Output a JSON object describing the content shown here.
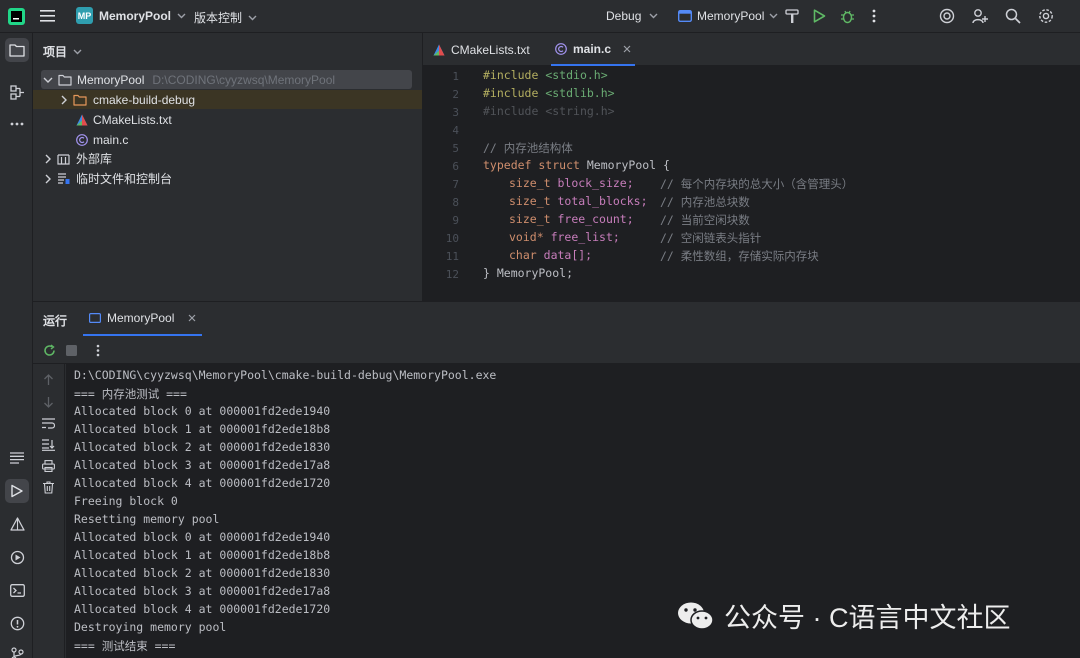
{
  "topbar": {
    "project_badge": "MP",
    "project_name": "MemoryPool",
    "vcs_label": "版本控制",
    "config_label": "Debug",
    "run_target": "MemoryPool"
  },
  "project_panel": {
    "title": "项目",
    "root_name": "MemoryPool",
    "root_path": "D:\\CODING\\cyyzwsq\\MemoryPool",
    "items": [
      {
        "label": "cmake-build-debug"
      },
      {
        "label": "CMakeLists.txt"
      },
      {
        "label": "main.c"
      },
      {
        "label": "外部库"
      },
      {
        "label": "临时文件和控制台"
      }
    ]
  },
  "editor": {
    "tabs": [
      {
        "label": "CMakeLists.txt"
      },
      {
        "label": "main.c"
      }
    ],
    "line_numbers": [
      "1",
      "2",
      "3",
      "4",
      "5",
      "6",
      "7",
      "8",
      "9",
      "10",
      "11",
      "12"
    ],
    "lines": {
      "l1_kw": "#include",
      "l1_val": "<stdio.h>",
      "l2_kw": "#include",
      "l2_val": "<stdlib.h>",
      "l3_kw": "#include",
      "l3_val": "<string.h>",
      "l5": "// 内存池结构体",
      "l6_kw": "typedef struct",
      "l6_rest": " MemoryPool {",
      "l7_type": "size_t",
      "l7_field": "block_size;",
      "l7_cm": "// 每个内存块的总大小（含管理头）",
      "l8_type": "size_t",
      "l8_field": "total_blocks;",
      "l8_cm": "// 内存池总块数",
      "l9_type": "size_t",
      "l9_field": "free_count;",
      "l9_cm": "// 当前空闲块数",
      "l10_type": "void*",
      "l10_field": "free_list;",
      "l10_cm": "// 空闲链表头指针",
      "l11_type": "char",
      "l11_field": "data[];",
      "l11_cm": "// 柔性数组，存储实际内存块",
      "l12": "} MemoryPool;"
    }
  },
  "run": {
    "title": "运行",
    "tab_label": "MemoryPool",
    "console": [
      "D:\\CODING\\cyyzwsq\\MemoryPool\\cmake-build-debug\\MemoryPool.exe",
      "=== 内存池测试 ===",
      "Allocated block 0 at 000001fd2ede1940",
      "Allocated block 1 at 000001fd2ede18b8",
      "Allocated block 2 at 000001fd2ede1830",
      "Allocated block 3 at 000001fd2ede17a8",
      "Allocated block 4 at 000001fd2ede1720",
      "Freeing block 0",
      "Resetting memory pool",
      "Allocated block 0 at 000001fd2ede1940",
      "Allocated block 1 at 000001fd2ede18b8",
      "Allocated block 2 at 000001fd2ede1830",
      "Allocated block 3 at 000001fd2ede17a8",
      "Allocated block 4 at 000001fd2ede1720",
      "Destroying memory pool",
      "=== 测试结束 ==="
    ]
  },
  "watermark": {
    "text": "公众号 · C语言中文社区"
  },
  "colors": {
    "accent": "#3574f0",
    "run_green": "#5fb865",
    "badge": "#2f9eaf"
  }
}
